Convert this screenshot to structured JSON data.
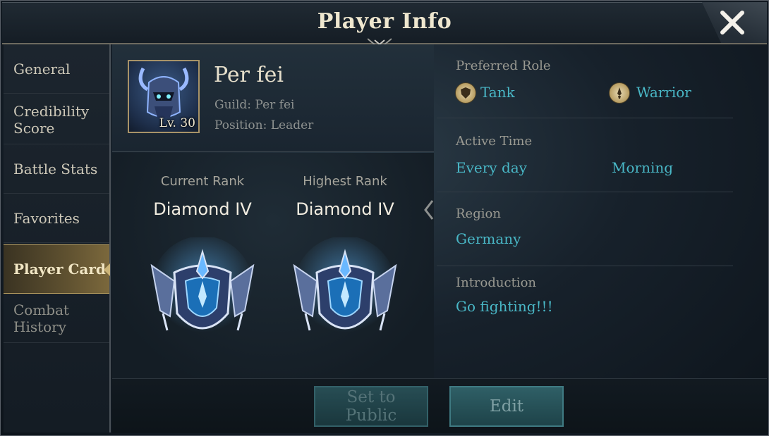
{
  "header": {
    "title": "Player Info",
    "close_icon": "close-icon"
  },
  "sidebar": {
    "items": [
      {
        "label": "General"
      },
      {
        "label": "Credibility\nScore"
      },
      {
        "label": "Battle Stats"
      },
      {
        "label": "Favorites"
      },
      {
        "label": "Player Card",
        "active": true
      },
      {
        "label": "Combat\nHistory"
      }
    ]
  },
  "profile": {
    "name": "Per fei",
    "level": "Lv. 30",
    "guild": "Guild: Per fei",
    "position": "Position: Leader"
  },
  "rank": {
    "current_label": "Current Rank",
    "current_value": "Diamond IV",
    "highest_label": "Highest Rank",
    "highest_value": "Diamond IV"
  },
  "info": {
    "role_label": "Preferred Role",
    "roles": [
      "Tank",
      "Warrior"
    ],
    "active_label": "Active Time",
    "active_values": [
      "Every day",
      "Morning"
    ],
    "region_label": "Region",
    "region_value": "Germany",
    "intro_label": "Introduction",
    "intro_value": "Go fighting!!!"
  },
  "buttons": {
    "set_public": "Set to\nPublic",
    "edit": "Edit"
  },
  "colors": {
    "accent": "#49b7c6",
    "gold": "#cbb479",
    "button": "#2f5f66"
  }
}
